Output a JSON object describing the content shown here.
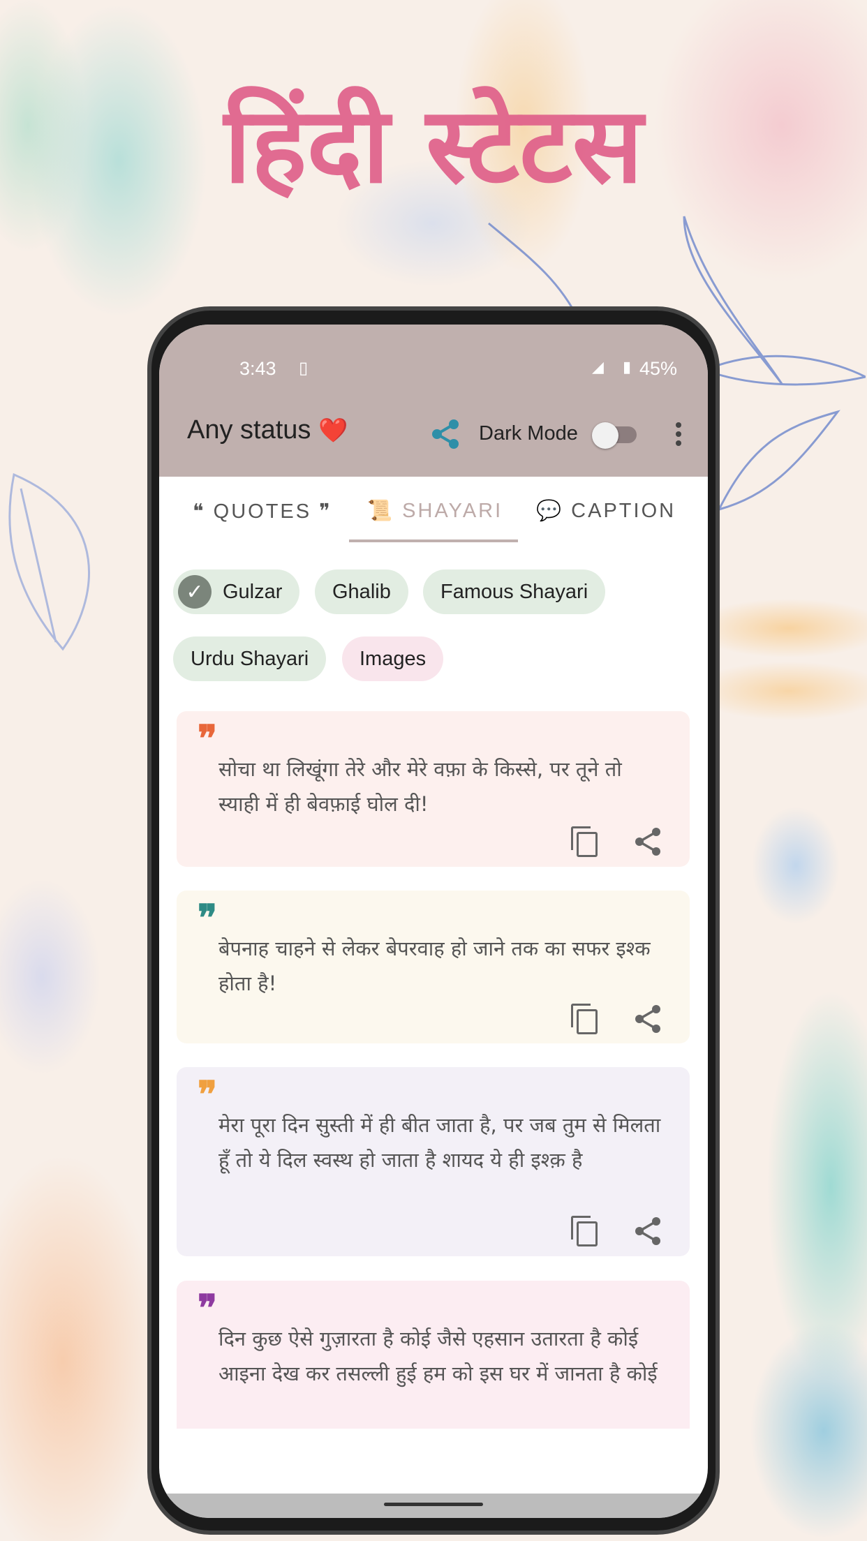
{
  "promo_title": "हिंदी स्टेटस",
  "status_bar": {
    "time": "3:43",
    "battery": "45%"
  },
  "app_bar": {
    "title": "Any status",
    "title_emoji": "❤️",
    "dark_mode_label": "Dark Mode",
    "dark_mode_on": false,
    "accent": "#2e8fa8"
  },
  "tabs": [
    {
      "label": "❝ QUOTES ❞",
      "active": false
    },
    {
      "label": "📜 SHAYARI",
      "active": true
    },
    {
      "label": "💬 CAPTION",
      "active": false
    }
  ],
  "chips": [
    {
      "label": "Gulzar",
      "selected": true
    },
    {
      "label": "Ghalib"
    },
    {
      "label": "Famous Shayari"
    },
    {
      "label": "Urdu Shayari"
    },
    {
      "label": "Images"
    }
  ],
  "cards": [
    {
      "text": "सोचा था लिखूंगा तेरे और मेरे वफ़ा के किस्से, पर तूने तो स्याही में ही बेवफ़ाई घोल दी!",
      "bg": "#fdf0ee",
      "quote_color": "#e8673a"
    },
    {
      "text": "बेपनाह चाहने से लेकर बेपरवाह हो जाने तक का सफर इश्क होता है!",
      "bg": "#fcf8ee",
      "quote_color": "#2e8b85"
    },
    {
      "text": "मेरा पूरा दिन सुस्ती में ही बीत जाता है, पर जब तुम से मिलता हूँ तो ये दिल स्वस्थ हो जाता है शायद ये ही इश्क़ है",
      "bg": "#f3f0f7",
      "quote_color": "#f0a040"
    },
    {
      "text": "दिन कुछ ऐसे गुज़ारता है कोई जैसे एहसान उतारता है कोई आइना देख कर तसल्ली हुई हम को इस घर में जानता है कोई",
      "bg": "#fcedf2",
      "quote_color": "#8e3aa0"
    }
  ]
}
